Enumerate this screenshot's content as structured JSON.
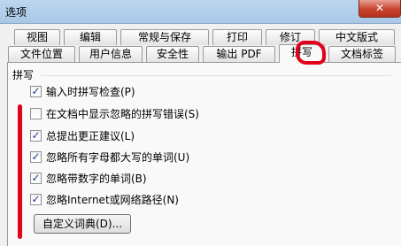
{
  "window": {
    "title": "选项",
    "close_label": "✕"
  },
  "tabs_row1": [
    "视图",
    "编辑",
    "常规与保存",
    "打印",
    "修订",
    "中文版式"
  ],
  "tabs_row2": [
    "文件位置",
    "用户信息",
    "安全性",
    "输出 PDF",
    "拼写",
    "文档标签"
  ],
  "active_tab": "拼写",
  "group": {
    "label": "拼写"
  },
  "options": [
    {
      "label": "输入时拼写检查(P)",
      "checked": true
    },
    {
      "label": "在文档中显示忽略的拼写错误(S)",
      "checked": false
    },
    {
      "label": "总提出更正建议(L)",
      "checked": true
    },
    {
      "label": "忽略所有字母都大写的单词(U)",
      "checked": true
    },
    {
      "label": "忽略带数字的单词(B)",
      "checked": true
    },
    {
      "label": "忽略Internet或网络路径(N)",
      "checked": true
    }
  ],
  "buttons": {
    "custom_dict": "自定义词典(D)..."
  },
  "colors": {
    "annotation": "#e2001a",
    "titlebar": "#bcd6ee"
  }
}
